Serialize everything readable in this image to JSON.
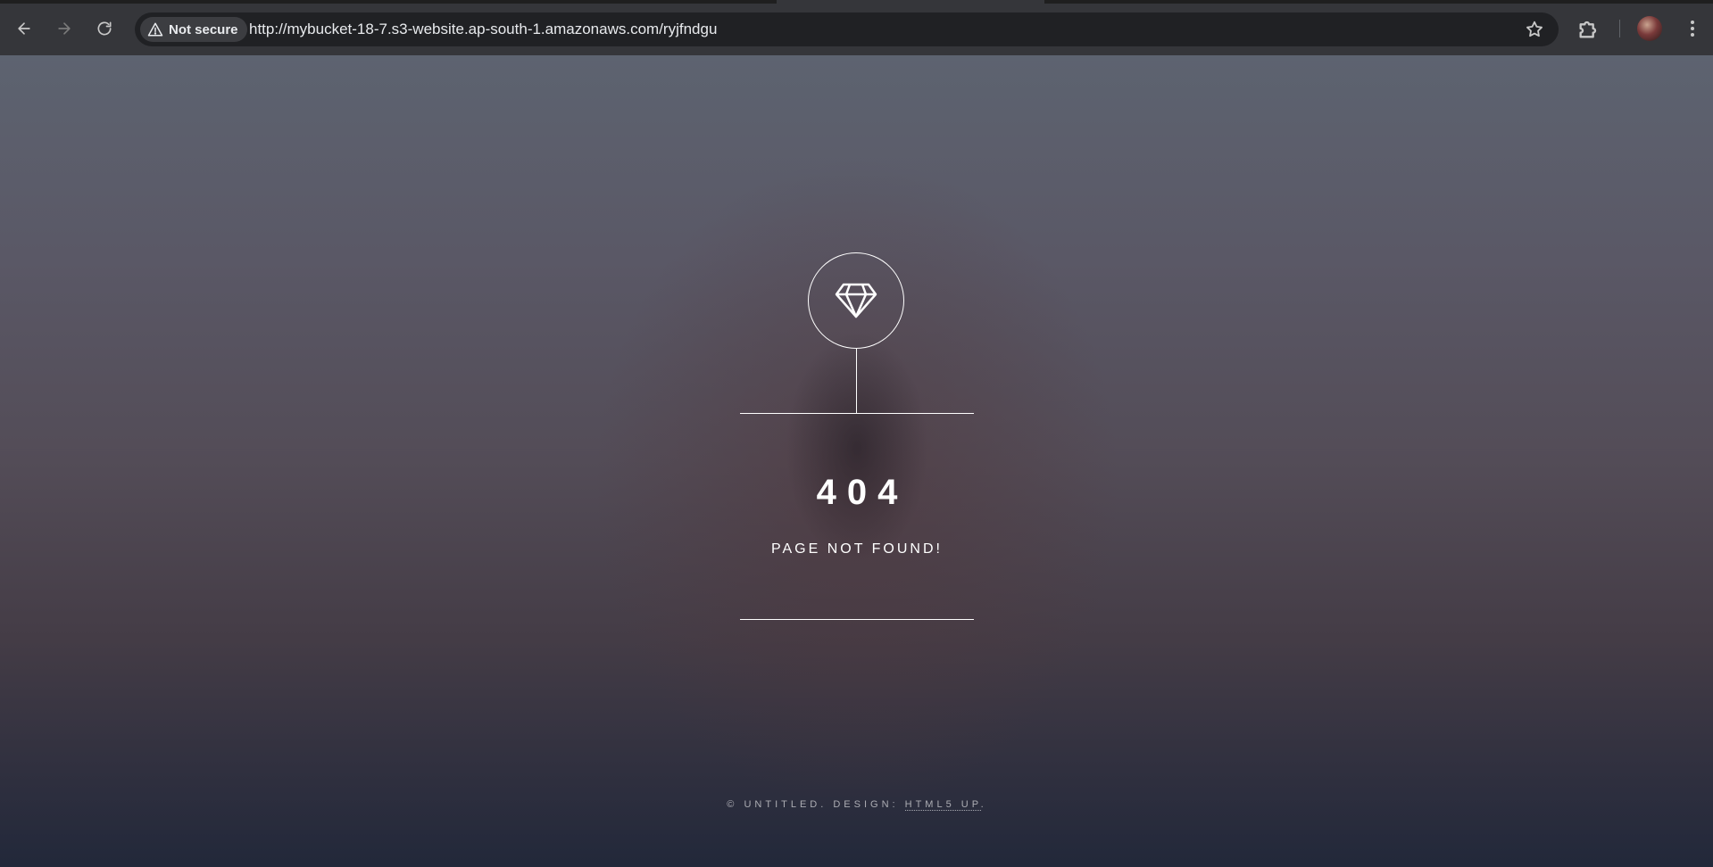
{
  "browser": {
    "security_label": "Not secure",
    "url": "http://mybucket-18-7.s3-website.ap-south-1.amazonaws.com/ryjfndgu",
    "icons": {
      "back": "back-arrow-icon",
      "forward": "forward-arrow-icon",
      "reload": "reload-icon",
      "warning": "warning-triangle-icon",
      "bookmark": "star-icon",
      "extensions": "puzzle-piece-icon",
      "menu": "kebab-menu-icon"
    }
  },
  "page": {
    "logo_icon": "diamond-icon",
    "error_code": "404",
    "message": "PAGE NOT FOUND!",
    "footer": {
      "prefix": "© UNTITLED. DESIGN: ",
      "link": "HTML5 UP",
      "suffix": "."
    }
  },
  "colors": {
    "chrome_bg": "#35363a",
    "omnibox_bg": "#202124",
    "text_white": "#ffffff"
  }
}
